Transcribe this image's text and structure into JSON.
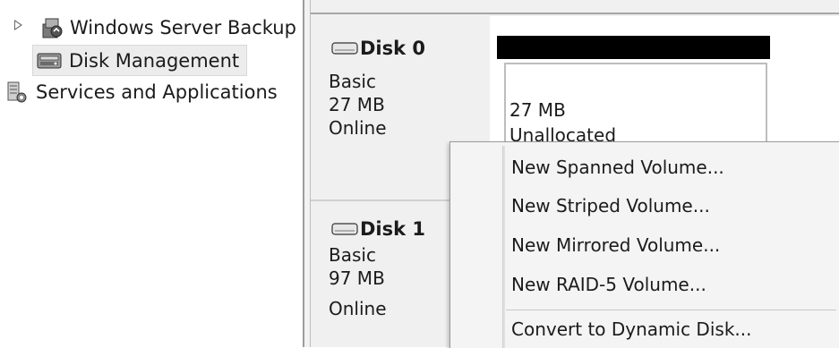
{
  "tree": {
    "items": [
      {
        "label": "Windows Server Backup",
        "icon": "backup-icon"
      },
      {
        "label": "Disk Management",
        "icon": "disk-management-icon",
        "selected": true
      },
      {
        "label": "Services and Applications",
        "icon": "services-icon"
      }
    ]
  },
  "disks": [
    {
      "name": "Disk 0",
      "type": "Basic",
      "size": "27 MB",
      "status": "Online",
      "volume": {
        "size": "27 MB",
        "state": "Unallocated"
      }
    },
    {
      "name": "Disk 1",
      "type": "Basic",
      "size": "97 MB",
      "status": "Online"
    }
  ],
  "context_menu": {
    "items": [
      {
        "label": "New Spanned Volume..."
      },
      {
        "label": "New Striped Volume..."
      },
      {
        "label": "New Mirrored Volume..."
      },
      {
        "label": "New RAID-5 Volume..."
      },
      {
        "label": "Convert to Dynamic Disk..."
      }
    ]
  }
}
